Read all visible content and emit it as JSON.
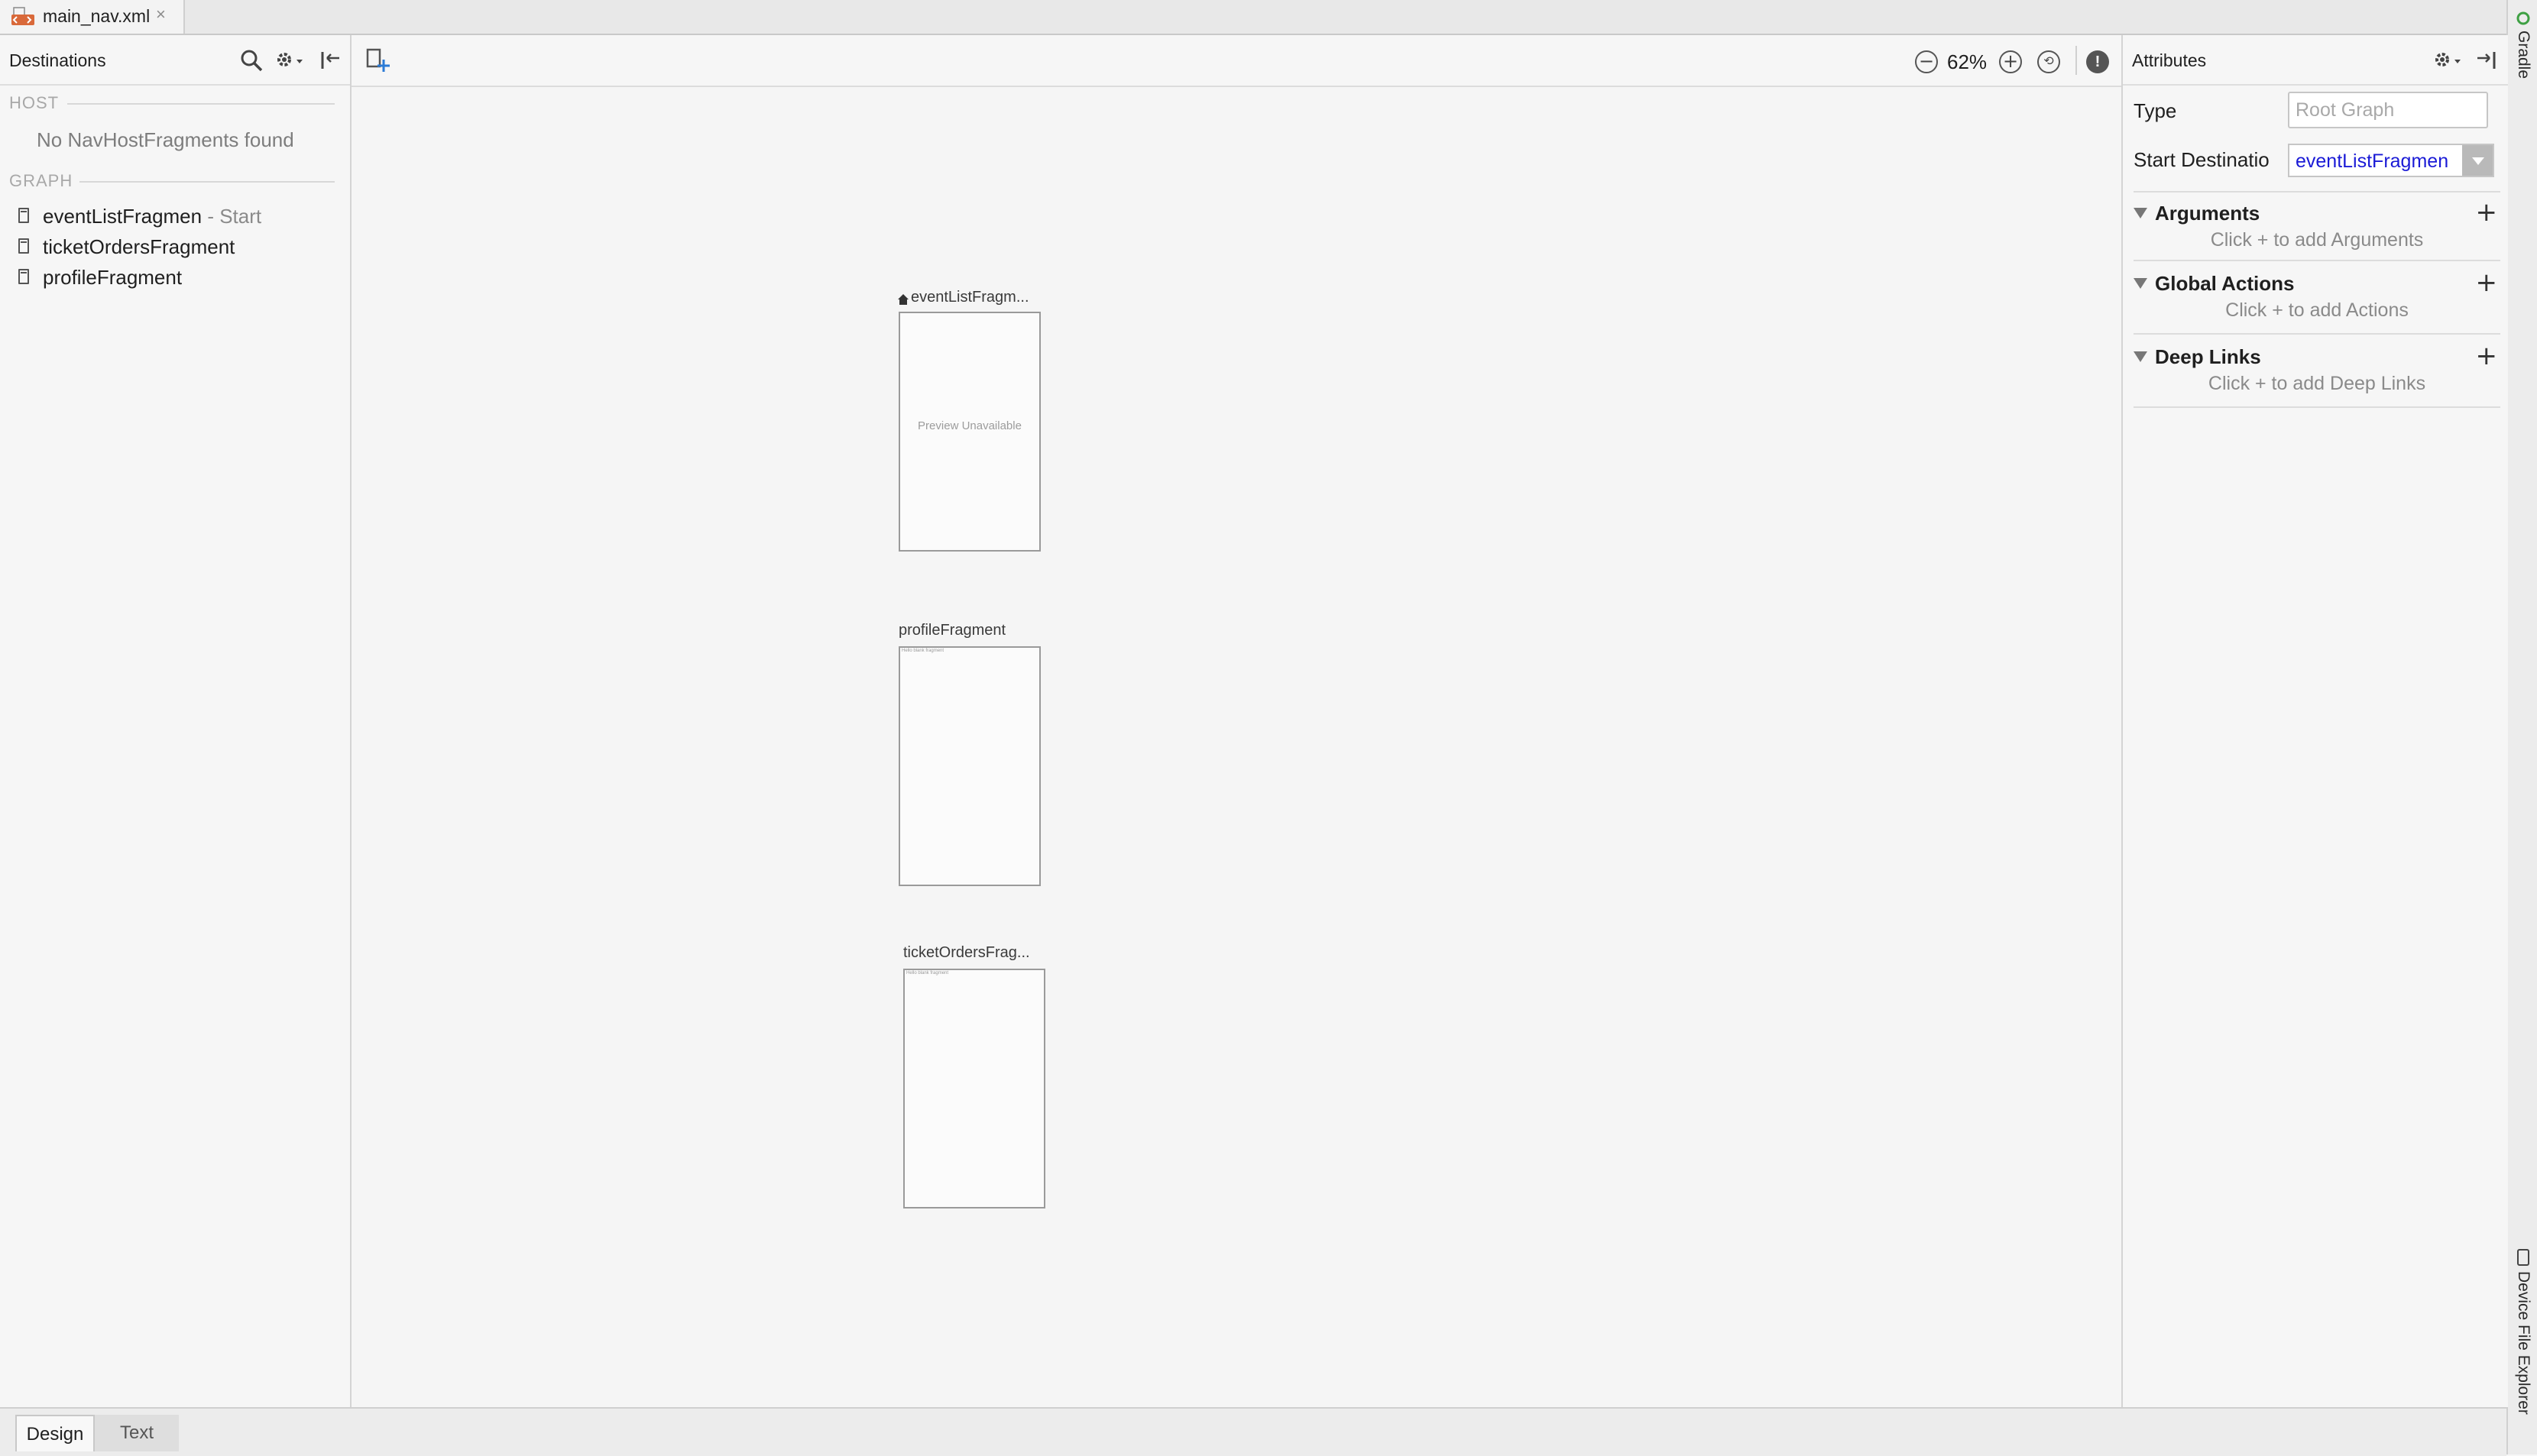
{
  "file_tab": {
    "name": "main_nav.xml",
    "close": "×",
    "icon": "xml-file-icon"
  },
  "left_panel": {
    "title": "Destinations",
    "icons": [
      "search-icon",
      "gear-dropdown-icon",
      "collapse-panel-icon"
    ],
    "host_label": "HOST",
    "host_empty": "No NavHostFragments found",
    "graph_label": "GRAPH",
    "destinations": [
      {
        "name": "eventListFragmen",
        "suffix": " - Start"
      },
      {
        "name": "ticketOrdersFragment",
        "suffix": ""
      },
      {
        "name": "profileFragment",
        "suffix": ""
      }
    ]
  },
  "canvas": {
    "toolbar": {
      "zoom": "62%",
      "icons": [
        "new-destination-icon",
        "zoom-out-icon",
        "zoom-in-icon",
        "zoom-to-fit-icon",
        "warning-icon"
      ]
    },
    "nodes": [
      {
        "title": "eventListFragm...",
        "start": true,
        "preview": "Preview Unavailable",
        "tiny": ""
      },
      {
        "title": "profileFragment",
        "start": false,
        "preview": "",
        "tiny": "Hello blank fragment"
      },
      {
        "title": "ticketOrdersFrag...",
        "start": false,
        "preview": "",
        "tiny": "Hello blank fragment"
      }
    ]
  },
  "attributes": {
    "title": "Attributes",
    "type_label": "Type",
    "type_placeholder": "Root Graph",
    "start_label": "Start Destinatio",
    "start_value": "eventListFragmen",
    "sections": [
      {
        "title": "Arguments",
        "hint": "Click + to add Arguments"
      },
      {
        "title": "Global Actions",
        "hint": "Click + to add Actions"
      },
      {
        "title": "Deep Links",
        "hint": "Click + to add Deep Links"
      }
    ]
  },
  "right_stripe": {
    "top": "Gradle",
    "bottom": "Device File Explorer"
  },
  "bottom_tabs": {
    "design": "Design",
    "text": "Text"
  },
  "colors": {
    "link_blue": "#1a1ad6",
    "xml_icon": "#d9693a",
    "gradle_green": "#3ea043"
  }
}
